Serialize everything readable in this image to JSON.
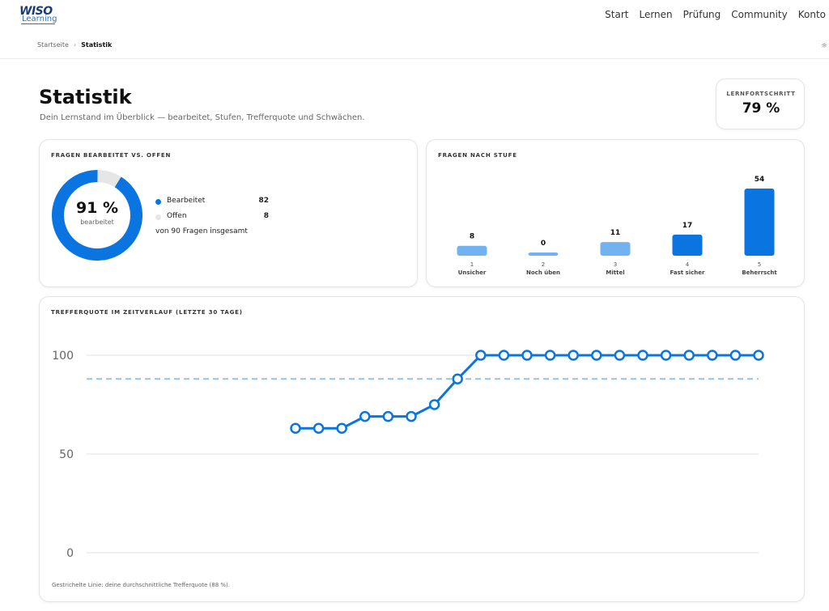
{
  "logo": {
    "top": "WISO",
    "bottom": "Learning"
  },
  "nav": {
    "items": [
      "Start",
      "Lernen",
      "Prüfung",
      "Community",
      "Konto"
    ]
  },
  "breadcrumb": {
    "home": "Startseite",
    "separator": "›",
    "current": "Statistik"
  },
  "theme_icon": "☼",
  "header": {
    "title": "Statistik",
    "subtitle": "Dein Lernstand im Überblick — bearbeitet, Stufen, Trefferquote und Schwächen."
  },
  "progress": {
    "label": "LERNFORTSCHRITT",
    "value": "79 %"
  },
  "donut_card": {
    "title": "FRAGEN BEARBEITET VS. OFFEN",
    "percent": "91 %",
    "center_label": "bearbeitet",
    "legend": [
      {
        "name": "Bearbeitet",
        "value": "82",
        "color": "#0a74e0"
      },
      {
        "name": "Offen",
        "value": "8",
        "color": "#e6e6e6"
      }
    ],
    "total_text": "von 90 Fragen insgesamt"
  },
  "bars_card": {
    "title": "FRAGEN NACH STUFE"
  },
  "line_card": {
    "title": "TREFFERQUOTE IM ZEITVERLAUF (LETZTE 30 TAGE)",
    "note": "Gestrichelte Linie: deine durchschnittliche Trefferquote (88 %)."
  },
  "colors": {
    "primary": "#0a74e0",
    "light": "#72b2f0",
    "track": "#e6e6e6",
    "dashed": "#8cc4f5"
  },
  "chart_data": [
    {
      "type": "pie",
      "title": "FRAGEN BEARBEITET VS. OFFEN",
      "categories": [
        "Bearbeitet",
        "Offen"
      ],
      "values": [
        82,
        8
      ]
    },
    {
      "type": "bar",
      "title": "FRAGEN NACH STUFE",
      "categories": [
        "1",
        "2",
        "3",
        "4",
        "5"
      ],
      "category_labels": [
        "Unsicher",
        "Noch üben",
        "Mittel",
        "Fast sicher",
        "Beherrscht"
      ],
      "values": [
        8,
        0,
        11,
        17,
        54
      ],
      "highlight": [
        false,
        false,
        false,
        true,
        true
      ]
    },
    {
      "type": "line",
      "title": "TREFFERQUOTE IM ZEITVERLAUF (LETZTE 30 TAGE)",
      "ylim": [
        0,
        100
      ],
      "yticks": [
        0,
        50,
        100
      ],
      "x_start_index": 9,
      "x_count": 30,
      "values": [
        63,
        63,
        63,
        69,
        69,
        69,
        75,
        88,
        100,
        100,
        100,
        100,
        100,
        100,
        100,
        100,
        100,
        100,
        100,
        100,
        100
      ],
      "average": 88
    }
  ]
}
